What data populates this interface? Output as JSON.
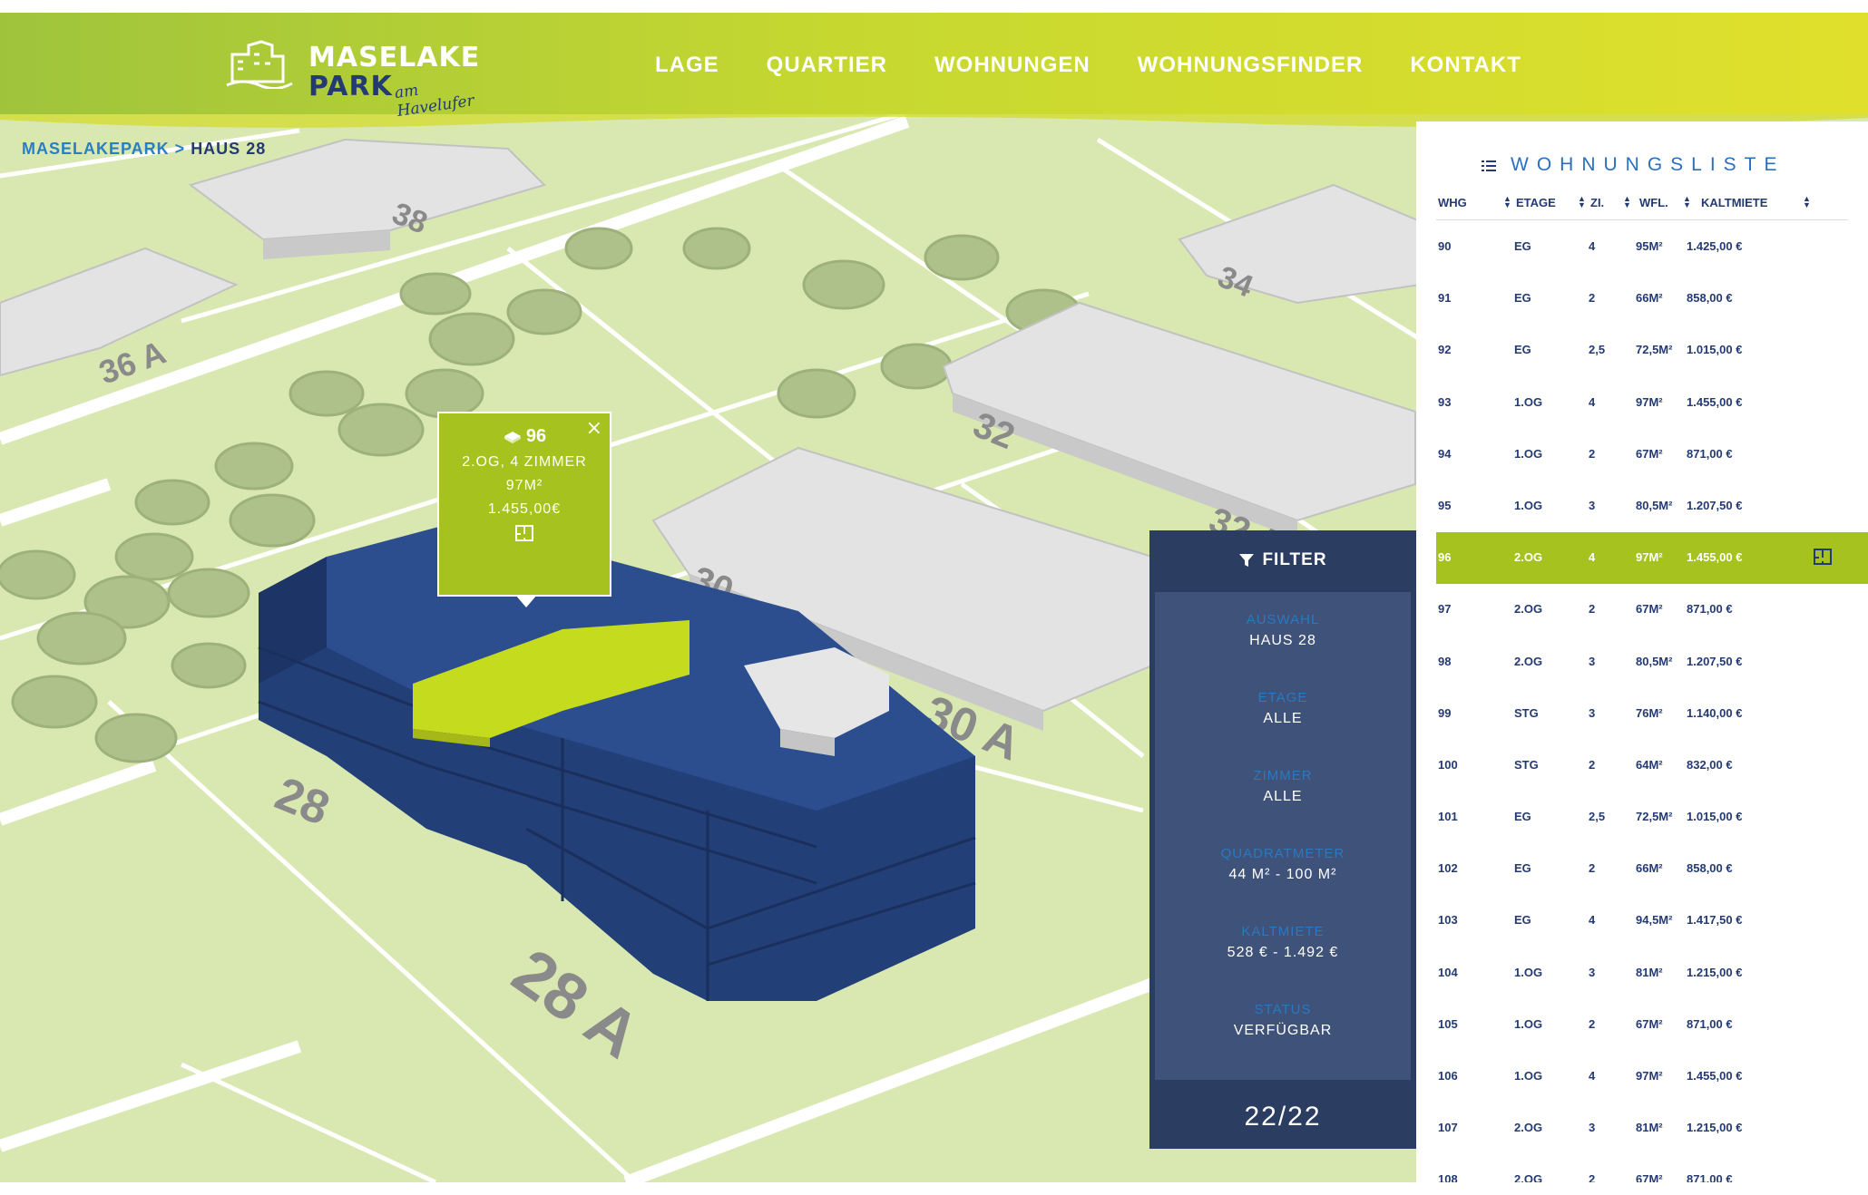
{
  "header": {
    "logo": {
      "line1": "MASELAKE",
      "line2": "PARK",
      "tagline": "am Havelufer"
    },
    "nav": [
      "LAGE",
      "QUARTIER",
      "WOHNUNGEN",
      "WOHNUNGSFINDER",
      "KONTAKT"
    ]
  },
  "breadcrumb": {
    "root": "MASELAKEPARK",
    "separator": ">",
    "current": "HAUS 28"
  },
  "map": {
    "house_labels": [
      "38",
      "36 A",
      "34",
      "32",
      "32 A",
      "30",
      "30 A",
      "28",
      "28 A"
    ],
    "colors": {
      "highlight": "#a6c21e",
      "building": "#23407a",
      "neighbor": "#e2e2e2",
      "ground": "#d9e7b0"
    }
  },
  "popup": {
    "icon": "building-icon",
    "number": "96",
    "floor_rooms": "2.OG, 4 ZIMMER",
    "area": "97M²",
    "rent": "1.455,00€",
    "close": "×"
  },
  "filter": {
    "title": "FILTER",
    "groups": [
      {
        "label": "AUSWAHL",
        "value": "HAUS 28"
      },
      {
        "label": "ETAGE",
        "value": "ALLE"
      },
      {
        "label": "ZIMMER",
        "value": "ALLE"
      },
      {
        "label": "QUADRATMETER",
        "value": "44 M² - 100 M²"
      },
      {
        "label": "KALTMIETE",
        "value": "528 € - 1.492 €"
      },
      {
        "label": "STATUS",
        "value": "VERFÜGBAR"
      }
    ],
    "count": "22/22"
  },
  "list": {
    "title": "WOHNUNGSLISTE",
    "columns": [
      "WHG",
      "ETAGE",
      "ZI.",
      "WFL.",
      "KALTMIETE"
    ],
    "rows": [
      [
        "90",
        "EG",
        "4",
        "95M²",
        "1.425,00 €"
      ],
      [
        "91",
        "EG",
        "2",
        "66M²",
        "858,00 €"
      ],
      [
        "92",
        "EG",
        "2,5",
        "72,5M²",
        "1.015,00 €"
      ],
      [
        "93",
        "1.OG",
        "4",
        "97M²",
        "1.455,00 €"
      ],
      [
        "94",
        "1.OG",
        "2",
        "67M²",
        "871,00 €"
      ],
      [
        "95",
        "1.OG",
        "3",
        "80,5M²",
        "1.207,50 €"
      ],
      [
        "96",
        "2.OG",
        "4",
        "97M²",
        "1.455,00 €"
      ],
      [
        "97",
        "2.OG",
        "2",
        "67M²",
        "871,00 €"
      ],
      [
        "98",
        "2.OG",
        "3",
        "80,5M²",
        "1.207,50 €"
      ],
      [
        "99",
        "STG",
        "3",
        "76M²",
        "1.140,00 €"
      ],
      [
        "100",
        "STG",
        "2",
        "64M²",
        "832,00 €"
      ],
      [
        "101",
        "EG",
        "2,5",
        "72,5M²",
        "1.015,00 €"
      ],
      [
        "102",
        "EG",
        "2",
        "66M²",
        "858,00 €"
      ],
      [
        "103",
        "EG",
        "4",
        "94,5M²",
        "1.417,50 €"
      ],
      [
        "104",
        "1.OG",
        "3",
        "81M²",
        "1.215,00 €"
      ],
      [
        "105",
        "1.OG",
        "2",
        "67M²",
        "871,00 €"
      ],
      [
        "106",
        "1.OG",
        "4",
        "97M²",
        "1.455,00 €"
      ],
      [
        "107",
        "2.OG",
        "3",
        "81M²",
        "1.215,00 €"
      ],
      [
        "108",
        "2.OG",
        "2",
        "67M²",
        "871,00 €"
      ]
    ],
    "active_row": "96"
  }
}
